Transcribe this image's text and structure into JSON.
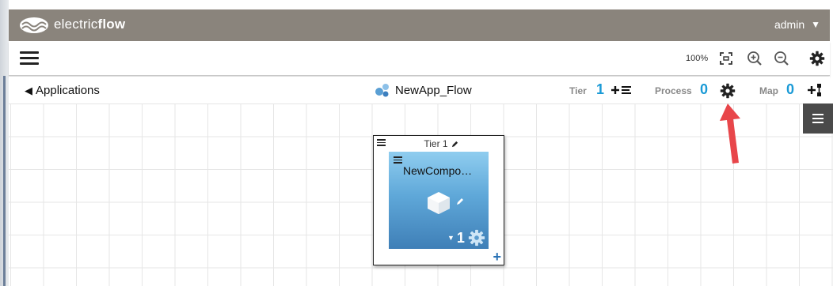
{
  "app": {
    "brand_light": "electric",
    "brand_bold": "flow",
    "user": "admin",
    "colors": {
      "topbar": "#8a847c",
      "accent": "#1a9ad6",
      "component_top": "#8fcdef",
      "component_bottom": "#3f7fb7",
      "arrow": "#e8464a"
    }
  },
  "toolbar": {
    "menu_icon": "hamburger-icon",
    "zoom_level": "100%",
    "icons": [
      "fit-to-screen-icon",
      "zoom-in-icon",
      "zoom-out-icon",
      "gear-icon"
    ]
  },
  "subheader": {
    "back_label": "Applications",
    "app_name": "NewApp_Flow",
    "tier_label": "Tier",
    "tier_count": "1",
    "process_label": "Process",
    "process_count": "0",
    "map_label": "Map",
    "map_count": "0"
  },
  "canvas": {
    "tier": {
      "title": "Tier 1",
      "component": {
        "name": "NewCompo…",
        "count": "1"
      }
    }
  }
}
